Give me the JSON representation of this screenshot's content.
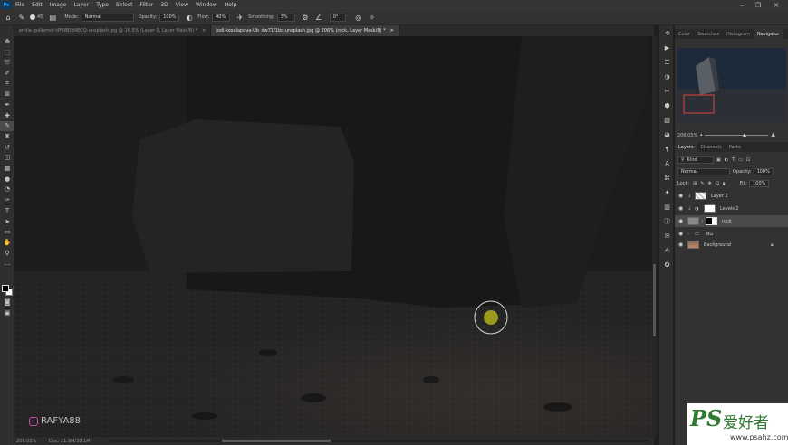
{
  "menubar": {
    "items": [
      "File",
      "Edit",
      "Image",
      "Layer",
      "Type",
      "Select",
      "Filter",
      "3D",
      "View",
      "Window",
      "Help"
    ],
    "app_logo": "Ps"
  },
  "options_bar": {
    "brush_size": "45",
    "mode_label": "Mode:",
    "mode_value": "Normal",
    "opacity_label": "Opacity:",
    "opacity_value": "100%",
    "flow_label": "Flow:",
    "flow_value": "40%",
    "smoothing_label": "Smoothing:",
    "smoothing_value": "3%",
    "angle_value": "0°"
  },
  "tabs": [
    {
      "label": "emile-guillemot-tIFWB0tAECQ-unsplash.jpg @ 16.5% (Layer 0, Layer Mask/8) *",
      "active": false
    },
    {
      "label": "jodi-kosolapova-Ub_dw71f1bc-unsplash.jpg @ 206% (rock, Layer Mask/8) *",
      "active": true
    }
  ],
  "canvas": {
    "watermark_handle": "RAFYA88",
    "brush_cursor_color": "#9a9a1e"
  },
  "status": {
    "zoom": "206.05%",
    "doc": "Doc: 11.9M/38.1M"
  },
  "panels": {
    "top_tabs": [
      "Color",
      "Swatches",
      "Histogram",
      "Navigator"
    ],
    "active_top_tab": "Navigator",
    "navigator_zoom": "206.05%",
    "layer_tabs": [
      "Layers",
      "Channels",
      "Paths"
    ],
    "filter_label": "Kind",
    "blend_mode": "Normal",
    "opacity_label": "Opacity:",
    "opacity_value": "100%",
    "lock_label": "Lock:",
    "fill_label": "Fill:",
    "fill_value": "100%",
    "layers": [
      {
        "name": "Layer 2",
        "selected": false
      },
      {
        "name": "Levels 2",
        "selected": false
      },
      {
        "name": "rock",
        "selected": true
      },
      {
        "name": "BG",
        "selected": false
      },
      {
        "name": "Background",
        "selected": false
      }
    ]
  },
  "site_watermark": {
    "logo": "PS",
    "chinese": "爱好者",
    "url": "www.psahz.com"
  },
  "colors": {
    "menubar_bg": "#353535",
    "panel_bg": "#323232",
    "selected_layer": "#4a4a4a",
    "accent_blue": "#31a8ff"
  }
}
